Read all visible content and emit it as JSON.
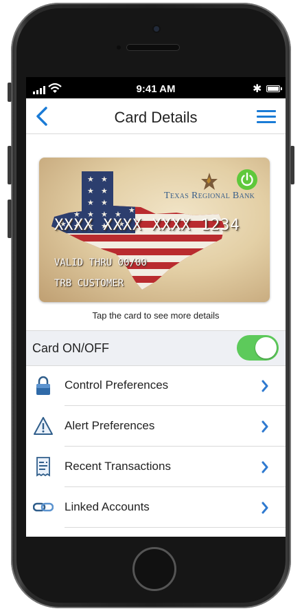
{
  "status": {
    "time": "9:41 AM"
  },
  "nav": {
    "title": "Card Details"
  },
  "card": {
    "bank_name": "Texas Regional Bank",
    "number": "XXXX XXXX XXXX 1234",
    "valid": "VALID THRU 00/00",
    "holder": "TRB CUSTOMER"
  },
  "hint": "Tap the card to see more details",
  "toggle": {
    "label": "Card ON/OFF",
    "state": "on"
  },
  "items": [
    {
      "label": "Control Preferences",
      "icon": "lock-icon"
    },
    {
      "label": "Alert Preferences",
      "icon": "alert-icon"
    },
    {
      "label": "Recent Transactions",
      "icon": "receipt-icon"
    },
    {
      "label": "Linked Accounts",
      "icon": "link-icon"
    }
  ],
  "colors": {
    "accent": "#1a7bd6",
    "toggle_on": "#5dca5b",
    "power": "#5fc83b",
    "bank_text": "#3a5f8a"
  }
}
